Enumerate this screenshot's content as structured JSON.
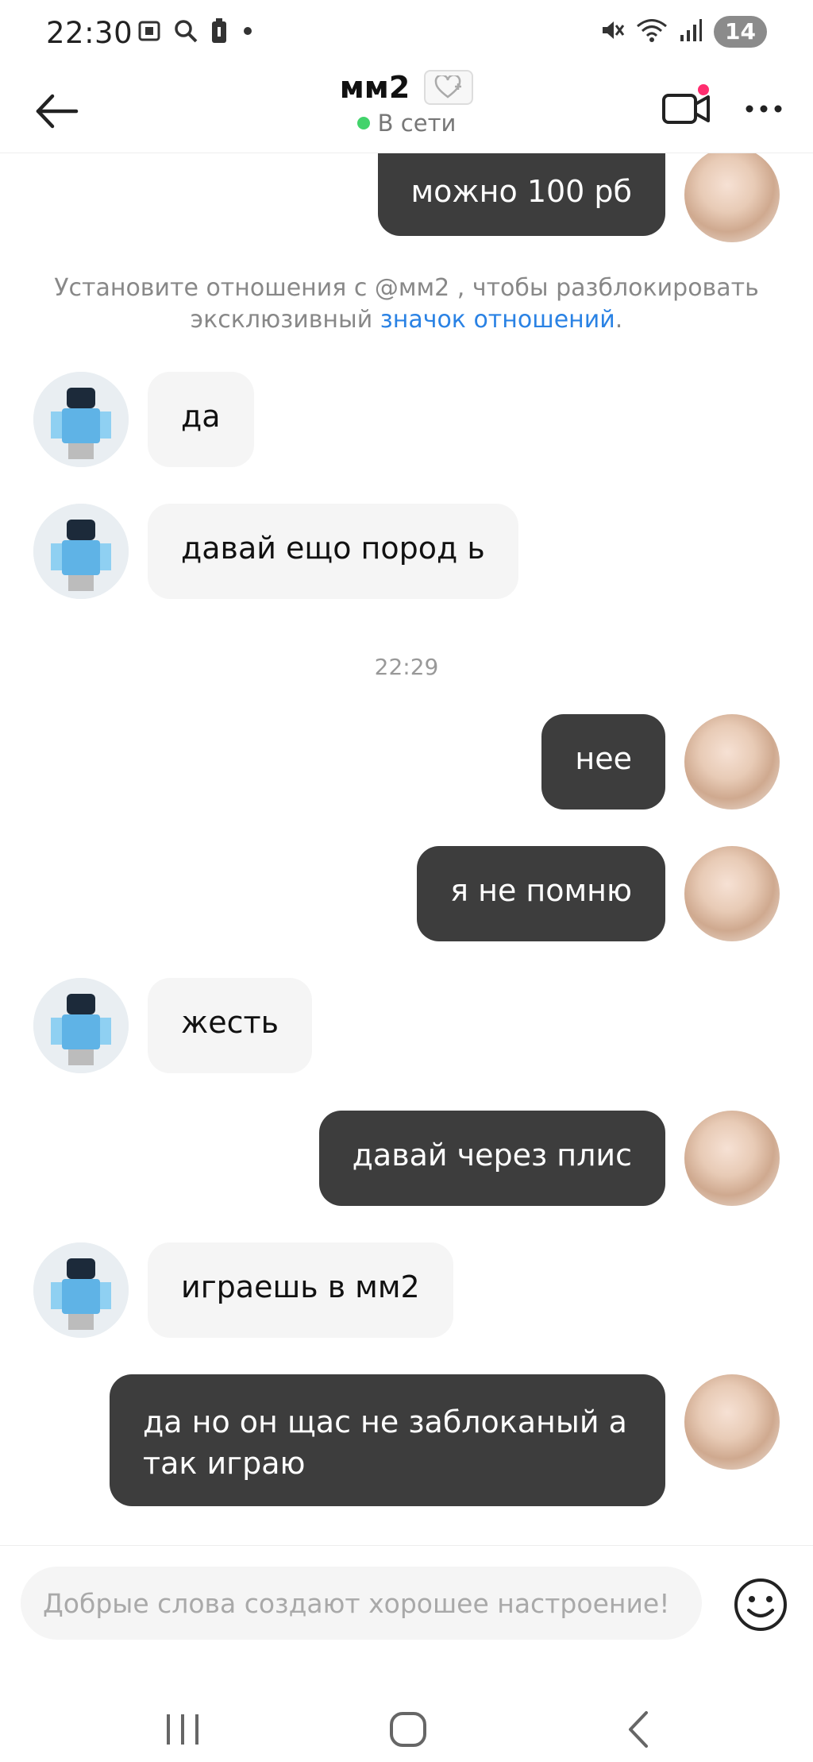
{
  "status_bar": {
    "time": "22:30",
    "left_icons": [
      "screenshot-icon",
      "search-icon",
      "battery-saver-icon",
      "dot-icon"
    ],
    "right_icons": [
      "mute-icon",
      "wifi-icon",
      "signal-icon"
    ],
    "badge": "14"
  },
  "header": {
    "title": "мм2",
    "status": "В сети",
    "online_color": "#42d36b"
  },
  "chat": {
    "system_note": {
      "text": "Установите отношения с @мм2 , чтобы разблокировать эксклюзивный ",
      "link": "значок отношений",
      "tail": "."
    },
    "timestamp": "22:29",
    "messages": [
      {
        "from": "me",
        "text": "можно 100 рб"
      },
      {
        "from": "other",
        "text": "да"
      },
      {
        "from": "other",
        "text": "давай ещо пород ь"
      },
      {
        "from": "me",
        "text": "нее"
      },
      {
        "from": "me",
        "text": "я не помню"
      },
      {
        "from": "other",
        "text": "жесть"
      },
      {
        "from": "me",
        "text": "давай через плис"
      },
      {
        "from": "other",
        "text": "играешь в мм2"
      },
      {
        "from": "me",
        "text": "да но он щас не заблоканый а так играю"
      }
    ]
  },
  "input": {
    "placeholder": "Добрые слова создают хорошее настроение!",
    "value": ""
  },
  "colors": {
    "my_bubble": "#3d3d3d",
    "other_bubble": "#f5f5f5",
    "link": "#2a82e4",
    "notification_dot": "#ff2d6f"
  }
}
